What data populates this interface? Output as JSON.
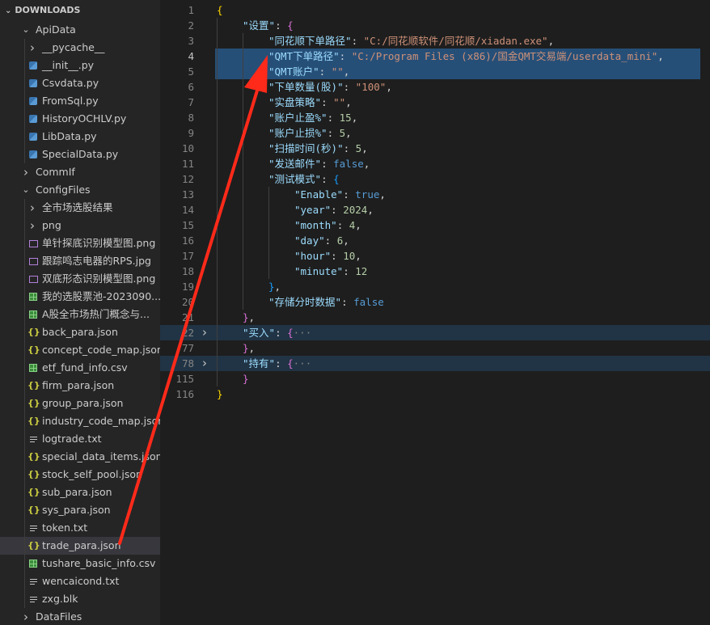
{
  "sidebar": {
    "header": "DOWNLOADS",
    "rows": [
      {
        "label": "ApiData",
        "indent": 1,
        "type": "folder",
        "open": true
      },
      {
        "label": "__pycache__",
        "indent": 2,
        "type": "folder",
        "open": false
      },
      {
        "label": "__init__.py",
        "indent": 2,
        "type": "py"
      },
      {
        "label": "Csvdata.py",
        "indent": 2,
        "type": "py"
      },
      {
        "label": "FromSql.py",
        "indent": 2,
        "type": "py"
      },
      {
        "label": "HistoryOCHLV.py",
        "indent": 2,
        "type": "py"
      },
      {
        "label": "LibData.py",
        "indent": 2,
        "type": "py"
      },
      {
        "label": "SpecialData.py",
        "indent": 2,
        "type": "py"
      },
      {
        "label": "CommIf",
        "indent": 1,
        "type": "folder",
        "open": false
      },
      {
        "label": "ConfigFiles",
        "indent": 1,
        "type": "folder",
        "open": true
      },
      {
        "label": "全市场选股结果",
        "indent": 2,
        "type": "folder",
        "open": false
      },
      {
        "label": "png",
        "indent": 2,
        "type": "folder",
        "open": false
      },
      {
        "label": "单针探底识别模型图.png",
        "indent": 2,
        "type": "img"
      },
      {
        "label": "跟踪鸣志电器的RPS.jpg",
        "indent": 2,
        "type": "img"
      },
      {
        "label": "双底形态识别模型图.png",
        "indent": 2,
        "type": "img"
      },
      {
        "label": "我的选股票池-2023090...",
        "indent": 2,
        "type": "csv"
      },
      {
        "label": "A股全市场热门概念与...",
        "indent": 2,
        "type": "csv"
      },
      {
        "label": "back_para.json",
        "indent": 2,
        "type": "json"
      },
      {
        "label": "concept_code_map.json",
        "indent": 2,
        "type": "json"
      },
      {
        "label": "etf_fund_info.csv",
        "indent": 2,
        "type": "csv"
      },
      {
        "label": "firm_para.json",
        "indent": 2,
        "type": "json"
      },
      {
        "label": "group_para.json",
        "indent": 2,
        "type": "json"
      },
      {
        "label": "industry_code_map.json",
        "indent": 2,
        "type": "json"
      },
      {
        "label": "logtrade.txt",
        "indent": 2,
        "type": "txt"
      },
      {
        "label": "special_data_items.json",
        "indent": 2,
        "type": "json"
      },
      {
        "label": "stock_self_pool.json",
        "indent": 2,
        "type": "json"
      },
      {
        "label": "sub_para.json",
        "indent": 2,
        "type": "json"
      },
      {
        "label": "sys_para.json",
        "indent": 2,
        "type": "json"
      },
      {
        "label": "token.txt",
        "indent": 2,
        "type": "txt"
      },
      {
        "label": "trade_para.json",
        "indent": 2,
        "type": "json",
        "selected": true
      },
      {
        "label": "tushare_basic_info.csv",
        "indent": 2,
        "type": "csv"
      },
      {
        "label": "wencaicond.txt",
        "indent": 2,
        "type": "txt"
      },
      {
        "label": "zxg.blk",
        "indent": 2,
        "type": "txt"
      },
      {
        "label": "DataFiles",
        "indent": 1,
        "type": "folder",
        "open": false
      }
    ]
  },
  "editor": {
    "lines": [
      {
        "num": "1",
        "indent": 0,
        "tokens": [
          [
            "br1",
            "{"
          ]
        ]
      },
      {
        "num": "2",
        "indent": 1,
        "fold": "open",
        "tokens": [
          [
            "k",
            "\"设置\""
          ],
          [
            "p",
            ": "
          ],
          [
            "br2",
            "{"
          ]
        ]
      },
      {
        "num": "3",
        "indent": 2,
        "tokens": [
          [
            "k",
            "\"同花顺下单路径\""
          ],
          [
            "p",
            ": "
          ],
          [
            "s",
            "\"C:/同花顺软件/同花顺/xiadan.exe\""
          ],
          [
            "p",
            ","
          ]
        ]
      },
      {
        "num": "4",
        "indent": 2,
        "hl": true,
        "cur": true,
        "tokens": [
          [
            "k",
            "\"QMT下单路径\""
          ],
          [
            "p",
            ": "
          ],
          [
            "s",
            "\"C:/Program Files (x86)/国金QMT交易端/userdata_mini\""
          ],
          [
            "p",
            ","
          ]
        ]
      },
      {
        "num": "5",
        "indent": 2,
        "hl": true,
        "tokens": [
          [
            "k",
            "\"QMT账户\""
          ],
          [
            "p",
            ": "
          ],
          [
            "s",
            "\"\""
          ],
          [
            "p",
            ","
          ]
        ]
      },
      {
        "num": "6",
        "indent": 2,
        "tokens": [
          [
            "k",
            "\"下单数量(股)\""
          ],
          [
            "p",
            ": "
          ],
          [
            "s",
            "\"100\""
          ],
          [
            "p",
            ","
          ]
        ]
      },
      {
        "num": "7",
        "indent": 2,
        "tokens": [
          [
            "k",
            "\"实盘策略\""
          ],
          [
            "p",
            ": "
          ],
          [
            "s",
            "\"\""
          ],
          [
            "p",
            ","
          ]
        ]
      },
      {
        "num": "8",
        "indent": 2,
        "tokens": [
          [
            "k",
            "\"账户止盈%\""
          ],
          [
            "p",
            ": "
          ],
          [
            "n",
            "15"
          ],
          [
            "p",
            ","
          ]
        ]
      },
      {
        "num": "9",
        "indent": 2,
        "tokens": [
          [
            "k",
            "\"账户止损%\""
          ],
          [
            "p",
            ": "
          ],
          [
            "n",
            "5"
          ],
          [
            "p",
            ","
          ]
        ]
      },
      {
        "num": "10",
        "indent": 2,
        "tokens": [
          [
            "k",
            "\"扫描时间(秒)\""
          ],
          [
            "p",
            ": "
          ],
          [
            "n",
            "5"
          ],
          [
            "p",
            ","
          ]
        ]
      },
      {
        "num": "11",
        "indent": 2,
        "tokens": [
          [
            "k",
            "\"发送邮件\""
          ],
          [
            "p",
            ": "
          ],
          [
            "b",
            "false"
          ],
          [
            "p",
            ","
          ]
        ]
      },
      {
        "num": "12",
        "indent": 2,
        "tokens": [
          [
            "k",
            "\"测试模式\""
          ],
          [
            "p",
            ": "
          ],
          [
            "br3",
            "{"
          ]
        ]
      },
      {
        "num": "13",
        "indent": 3,
        "tokens": [
          [
            "k",
            "\"Enable\""
          ],
          [
            "p",
            ": "
          ],
          [
            "b",
            "true"
          ],
          [
            "p",
            ","
          ]
        ]
      },
      {
        "num": "14",
        "indent": 3,
        "tokens": [
          [
            "k",
            "\"year\""
          ],
          [
            "p",
            ": "
          ],
          [
            "n",
            "2024"
          ],
          [
            "p",
            ","
          ]
        ]
      },
      {
        "num": "15",
        "indent": 3,
        "tokens": [
          [
            "k",
            "\"month\""
          ],
          [
            "p",
            ": "
          ],
          [
            "n",
            "4"
          ],
          [
            "p",
            ","
          ]
        ]
      },
      {
        "num": "16",
        "indent": 3,
        "tokens": [
          [
            "k",
            "\"day\""
          ],
          [
            "p",
            ": "
          ],
          [
            "n",
            "6"
          ],
          [
            "p",
            ","
          ]
        ]
      },
      {
        "num": "17",
        "indent": 3,
        "tokens": [
          [
            "k",
            "\"hour\""
          ],
          [
            "p",
            ": "
          ],
          [
            "n",
            "10"
          ],
          [
            "p",
            ","
          ]
        ]
      },
      {
        "num": "18",
        "indent": 3,
        "tokens": [
          [
            "k",
            "\"minute\""
          ],
          [
            "p",
            ": "
          ],
          [
            "n",
            "12"
          ]
        ]
      },
      {
        "num": "19",
        "indent": 2,
        "tokens": [
          [
            "br3",
            "}"
          ],
          [
            "p",
            ","
          ]
        ]
      },
      {
        "num": "20",
        "indent": 2,
        "tokens": [
          [
            "k",
            "\"存储分时数据\""
          ],
          [
            "p",
            ": "
          ],
          [
            "b",
            "false"
          ]
        ]
      },
      {
        "num": "21",
        "indent": 1,
        "tokens": [
          [
            "br2",
            "}"
          ],
          [
            "p",
            ","
          ]
        ]
      },
      {
        "num": "22",
        "indent": 1,
        "fold": "closed",
        "folded": true,
        "tokens": [
          [
            "k",
            "\"买入\""
          ],
          [
            "p",
            ": "
          ],
          [
            "br2",
            "{"
          ],
          [
            "ell",
            "···"
          ]
        ]
      },
      {
        "num": "77",
        "indent": 1,
        "tokens": [
          [
            "br2",
            "}"
          ],
          [
            "p",
            ","
          ]
        ]
      },
      {
        "num": "78",
        "indent": 1,
        "fold": "closed",
        "folded": true,
        "tokens": [
          [
            "k",
            "\"持有\""
          ],
          [
            "p",
            ": "
          ],
          [
            "br2",
            "{"
          ],
          [
            "ell",
            "···"
          ]
        ]
      },
      {
        "num": "115",
        "indent": 1,
        "tokens": [
          [
            "br2",
            "}"
          ]
        ]
      },
      {
        "num": "116",
        "indent": 0,
        "tokens": [
          [
            "br1",
            "}"
          ]
        ]
      }
    ]
  },
  "colors": {
    "annotation_arrow": "#ff2a1a",
    "selection": "#264f78"
  }
}
